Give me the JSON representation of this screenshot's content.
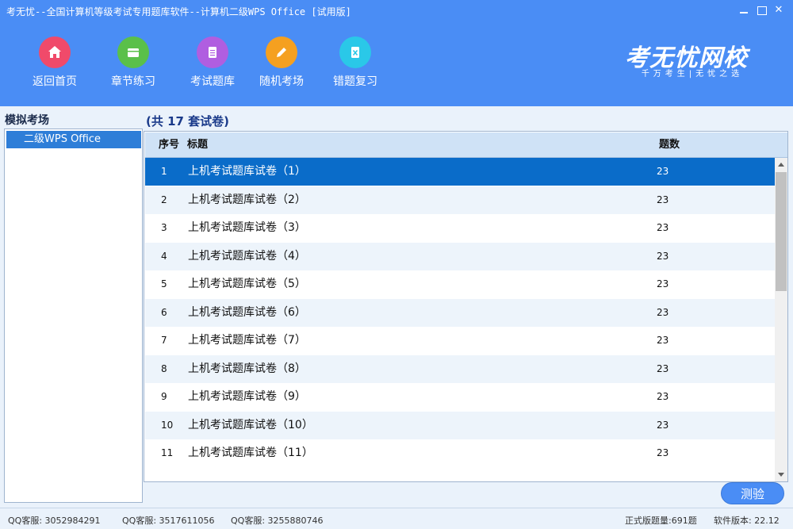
{
  "window": {
    "title": "考无忧--全国计算机等级考试专用题库软件--计算机二级WPS Office [试用版]",
    "minimize_label": "",
    "close_label": "✕"
  },
  "nav": [
    {
      "label": "返回首页",
      "icon": "home-icon",
      "color": "#f04a6a"
    },
    {
      "label": "章节练习",
      "icon": "book-icon",
      "color": "#5ac04a"
    },
    {
      "label": "考试题库",
      "icon": "document-icon",
      "color": "#b05ee0"
    },
    {
      "label": "随机考场",
      "icon": "pencil-icon",
      "color": "#f5a020"
    },
    {
      "label": "错题复习",
      "icon": "excel-file-icon",
      "color": "#2ac8e8"
    }
  ],
  "logo": {
    "main": "考无忧网校",
    "sub": "千万考生|无忧之选"
  },
  "left": {
    "title": "模拟考场",
    "items": [
      {
        "label": "二级WPS Office",
        "selected": true
      }
    ]
  },
  "exam": {
    "count_label": "(共 17 套试卷)",
    "columns": {
      "no": "序号",
      "title": "标题",
      "count": "题数"
    },
    "rows": [
      {
        "no": "1",
        "title": "上机考试题库试卷（1）",
        "count": "23"
      },
      {
        "no": "2",
        "title": "上机考试题库试卷（2）",
        "count": "23"
      },
      {
        "no": "3",
        "title": "上机考试题库试卷（3）",
        "count": "23"
      },
      {
        "no": "4",
        "title": "上机考试题库试卷（4）",
        "count": "23"
      },
      {
        "no": "5",
        "title": "上机考试题库试卷（5）",
        "count": "23"
      },
      {
        "no": "6",
        "title": "上机考试题库试卷（6）",
        "count": "23"
      },
      {
        "no": "7",
        "title": "上机考试题库试卷（7）",
        "count": "23"
      },
      {
        "no": "8",
        "title": "上机考试题库试卷（8）",
        "count": "23"
      },
      {
        "no": "9",
        "title": "上机考试题库试卷（9）",
        "count": "23"
      },
      {
        "no": "10",
        "title": "上机考试题库试卷（10）",
        "count": "23"
      },
      {
        "no": "11",
        "title": "上机考试题库试卷（11）",
        "count": "23"
      }
    ],
    "selected_index": 0,
    "test_button": "测验"
  },
  "status": {
    "qq1": "QQ客服: 3052984291",
    "qq2": "QQ客服: 3517611056",
    "qq3": "QQ客服: 3255880746",
    "total": "正式版题量:691题",
    "version": "软件版本: 22.12"
  },
  "colors": {
    "header": "#4a8df5",
    "selected_row": "#0a6cc9",
    "alt_row": "#edf4fb"
  }
}
